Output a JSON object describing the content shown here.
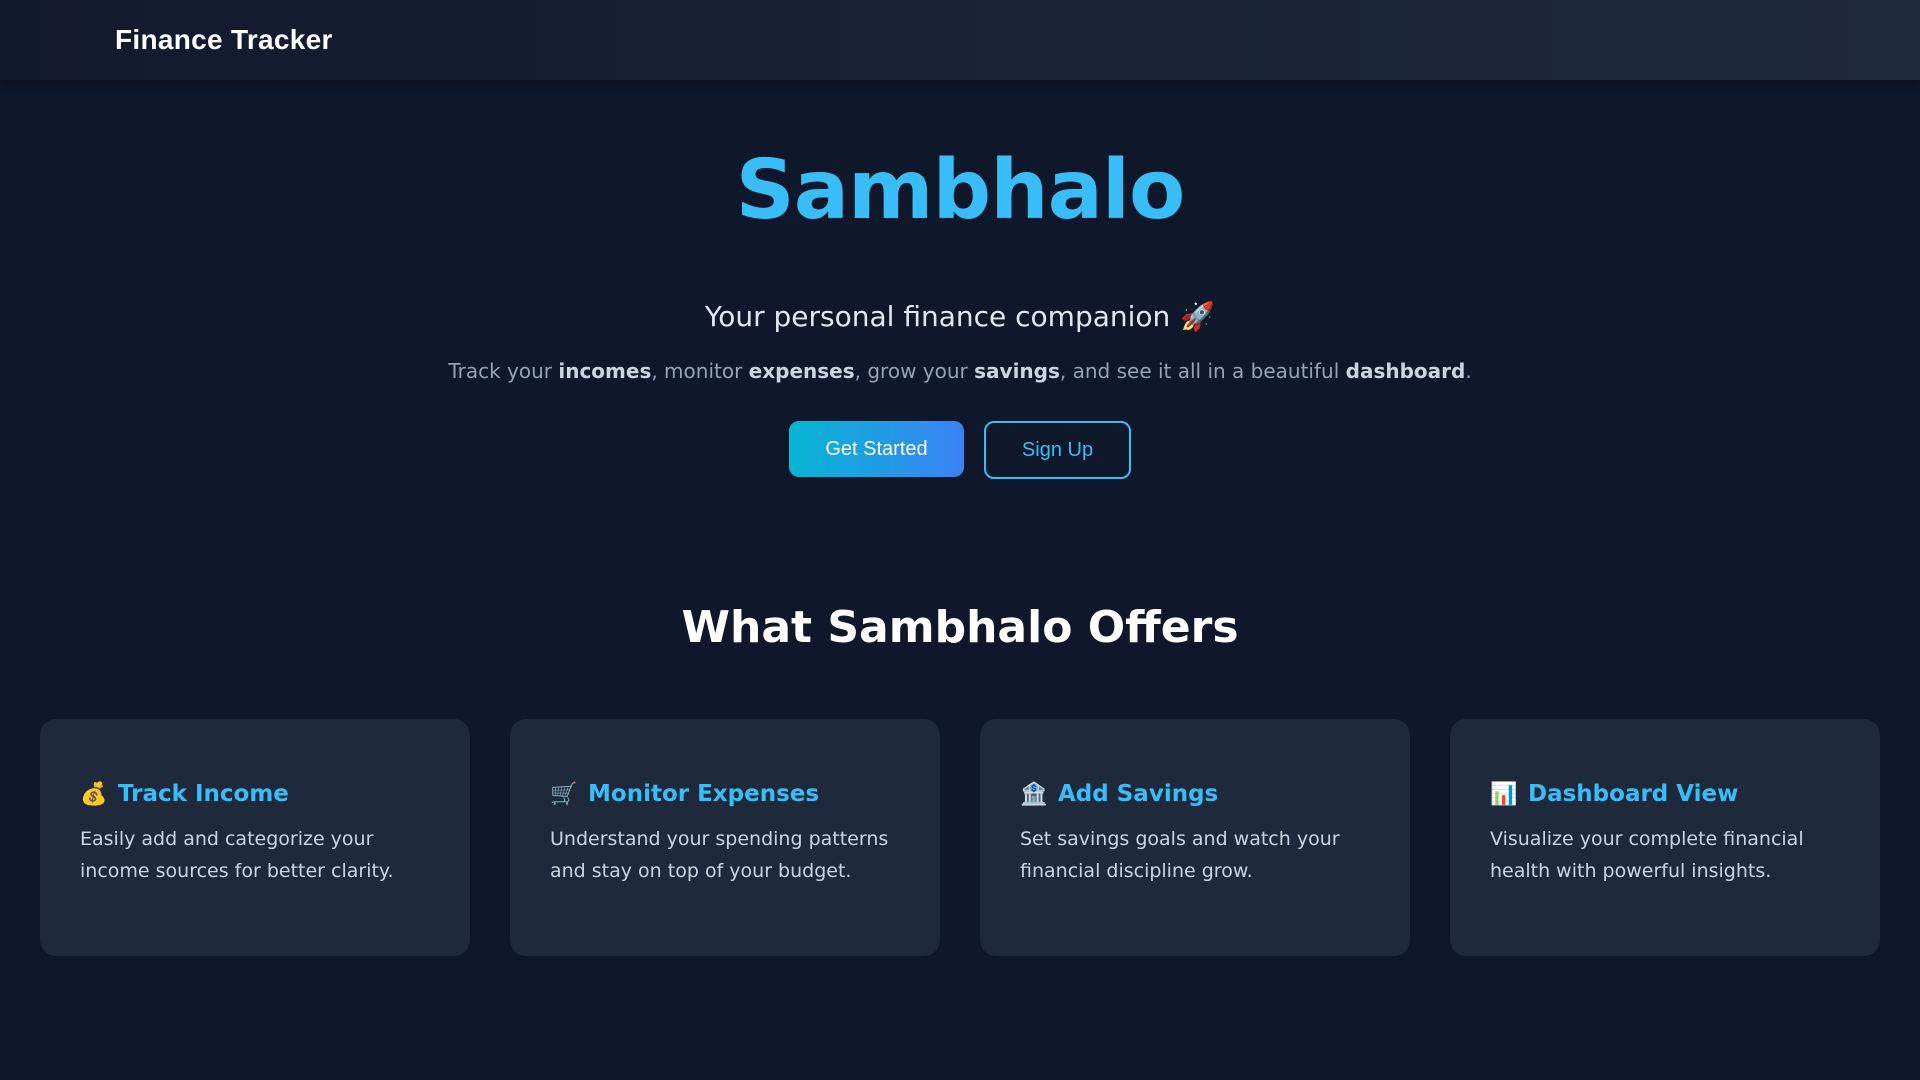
{
  "nav": {
    "brand": "Finance Tracker"
  },
  "hero": {
    "title": "Sambhalo",
    "tagline": "Your personal finance companion",
    "tagline_emoji": "🚀",
    "description": {
      "p1": "Track your ",
      "b1": "incomes",
      "p2": ", monitor ",
      "b2": "expenses",
      "p3": ", grow your ",
      "b3": "savings",
      "p4": ", and see it all in a beautiful ",
      "b4": "dashboard",
      "p5": "."
    },
    "buttons": {
      "primary": "Get Started",
      "secondary": "Sign Up"
    }
  },
  "offers": {
    "title": "What Sambhalo Offers",
    "cards": [
      {
        "icon": "💰",
        "icon_name": "money-bag-icon",
        "title": "Track Income",
        "text": "Easily add and categorize your income sources for better clarity."
      },
      {
        "icon": "🛒",
        "icon_name": "shopping-cart-icon",
        "title": "Monitor Expenses",
        "text": "Understand your spending patterns and stay on top of your budget."
      },
      {
        "icon": "🏦",
        "icon_name": "bank-icon",
        "title": "Add Savings",
        "text": "Set savings goals and watch your financial discipline grow."
      },
      {
        "icon": "📊",
        "icon_name": "bar-chart-icon",
        "title": "Dashboard View",
        "text": "Visualize your complete financial health with powerful insights."
      }
    ]
  },
  "colors": {
    "background": "#0f172a",
    "card": "#1e293b",
    "accent": "#38bdf8",
    "gradient_start": "#06b6d4",
    "gradient_end": "#3b82f6"
  }
}
